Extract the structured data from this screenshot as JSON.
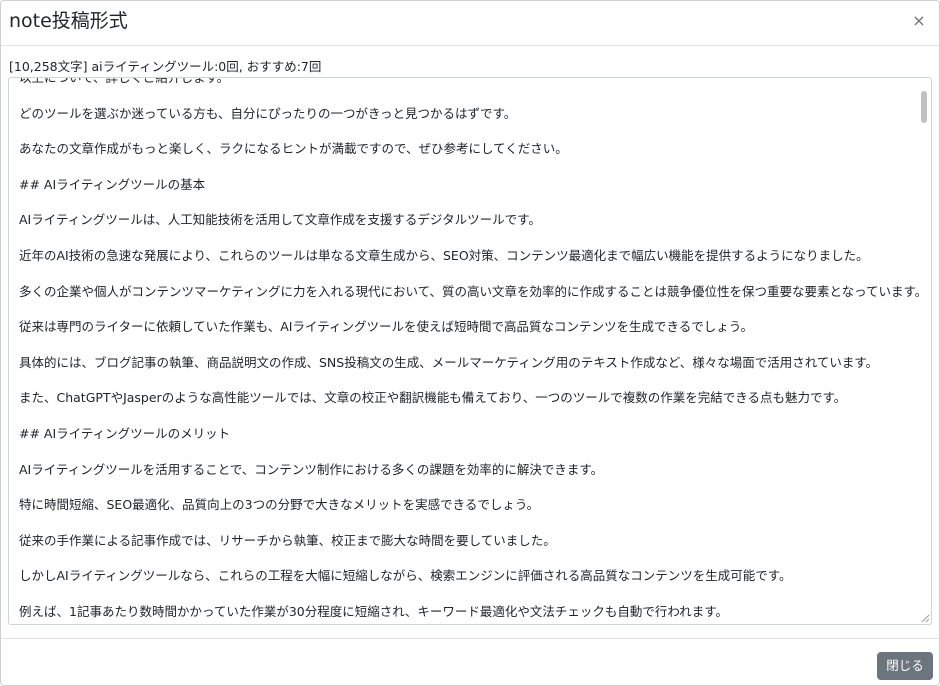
{
  "modal": {
    "title": "note投稿形式",
    "close_icon": "×",
    "info": "[10,258文字] aiライティングツール:0回, おすすめ:7回",
    "lines": [
      "以上について、詳しくご紹介します。",
      "どのツールを選ぶか迷っている方も、自分にぴったりの一つがきっと見つかるはずです。",
      "あなたの文章作成がもっと楽しく、ラクになるヒントが満載ですので、ぜひ参考にしてください。",
      "## AIライティングツールの基本",
      "AIライティングツールは、人工知能技術を活用して文章作成を支援するデジタルツールです。",
      "近年のAI技術の急速な発展により、これらのツールは単なる文章生成から、SEO対策、コンテンツ最適化まで幅広い機能を提供するようになりました。",
      "多くの企業や個人がコンテンツマーケティングに力を入れる現代において、質の高い文章を効率的に作成することは競争優位性を保つ重要な要素となっています。",
      "従来は専門のライターに依頼していた作業も、AIライティングツールを使えば短時間で高品質なコンテンツを生成できるでしょう。",
      "具体的には、ブログ記事の執筆、商品説明文の作成、SNS投稿文の生成、メールマーケティング用のテキスト作成など、様々な場面で活用されています。",
      "また、ChatGPTやJasperのような高性能ツールでは、文章の校正や翻訳機能も備えており、一つのツールで複数の作業を完結できる点も魅力です。",
      "## AIライティングツールのメリット",
      "AIライティングツールを活用することで、コンテンツ制作における多くの課題を効率的に解決できます。",
      "特に時間短縮、SEO最適化、品質向上の3つの分野で大きなメリットを実感できるでしょう。",
      "従来の手作業による記事作成では、リサーチから執筆、校正まで膨大な時間を要していました。",
      "しかしAIライティングツールなら、これらの工程を大幅に短縮しながら、検索エンジンに評価される高品質なコンテンツを生成可能です。",
      "例えば、1記事あたり数時間かかっていた作業が30分程度に短縮され、キーワード最適化や文法チェックも自動で行われます。"
    ],
    "footer_close_label": "閉じる"
  }
}
